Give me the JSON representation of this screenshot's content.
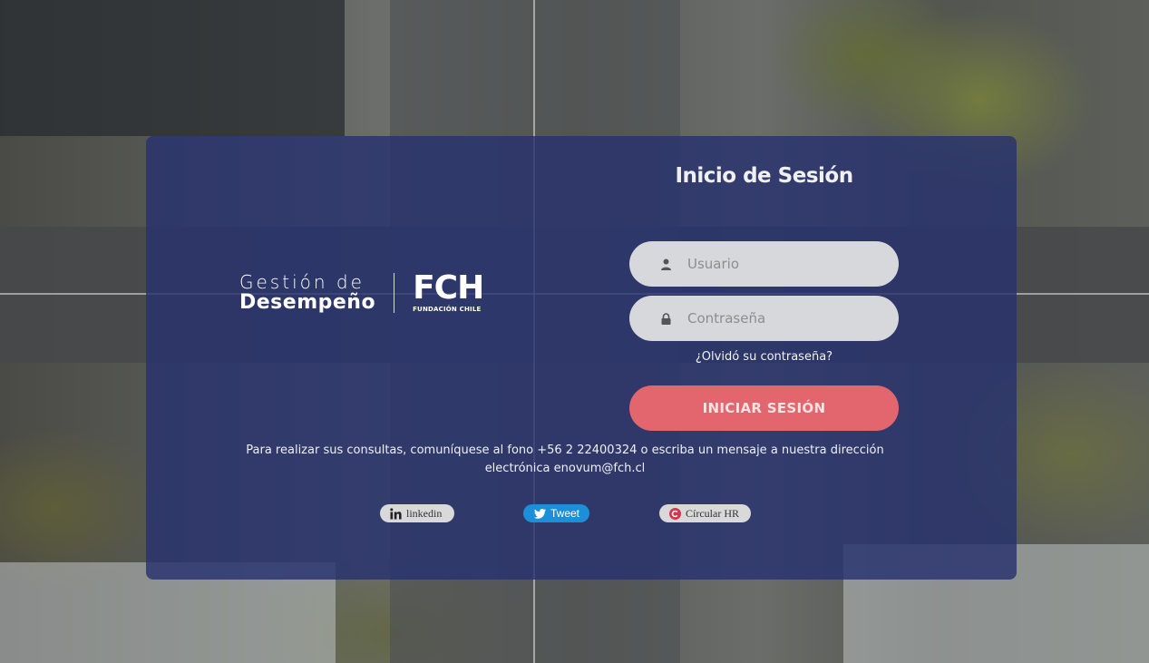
{
  "login": {
    "title": "Inicio de Sesión",
    "username_placeholder": "Usuario",
    "password_placeholder": "Contraseña",
    "forgot_link": "¿Olvidó su contraseña?",
    "submit_label": "INICIAR SESIÓN"
  },
  "brand": {
    "gestion_line1": "Gestión de",
    "gestion_line2": "Desempeño",
    "fch_mark": "FCH",
    "fch_sub": "FUNDACIÓN CHILE"
  },
  "contact_text": "Para realizar sus consultas, comuníquese al fono +56 2 22400324 o escriba un mensaje a nuestra dirección electrónica enovum@fch.cl",
  "social": {
    "linkedin_label": "linkedin",
    "tweet_label": "Tweet",
    "hr_label": "Círcular HR"
  },
  "icons": {
    "user": "user-icon",
    "lock": "lock-icon",
    "linkedin": "linkedin-icon",
    "twitter": "twitter-icon",
    "circular": "circular-hr-icon"
  },
  "colors": {
    "panel": "#27326e",
    "login_button": "#e3656d",
    "tweet_button": "#1d8fd8"
  }
}
